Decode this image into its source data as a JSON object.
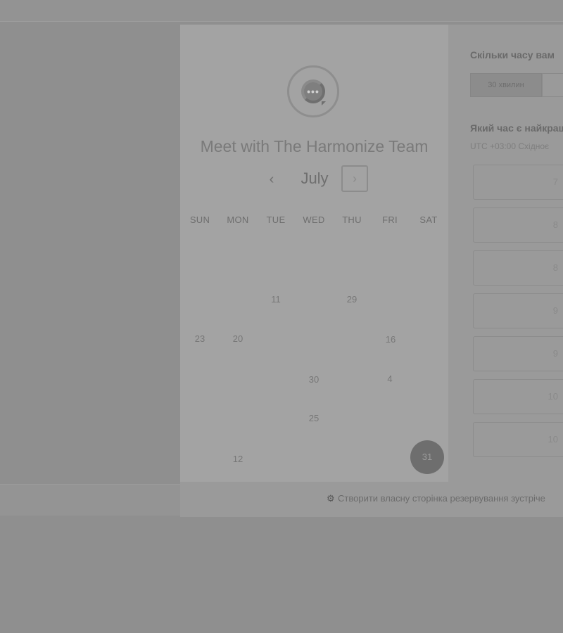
{
  "meeting": {
    "title": "Meet with The Harmonize Team",
    "avatar_icon": "chat-bubble-icon"
  },
  "calendar": {
    "month": "July",
    "prev_symbol": "‹",
    "next_symbol": "›",
    "weekdays": [
      "SUN",
      "MON",
      "TUE",
      "WED",
      "THU",
      "FRI",
      "SAT"
    ],
    "days": [
      "11",
      "29",
      "23",
      "20",
      "16",
      "30",
      "4",
      "25",
      "12",
      "31"
    ],
    "selected_day": "31"
  },
  "right_panel": {
    "duration_heading": "Скільки часу вам",
    "duration_tab": "30 хвилин",
    "time_heading": "Який час є найкращ",
    "timezone": "UTC +03:00 Східноє",
    "slots": [
      "7",
      "8",
      "8",
      "9",
      "9",
      "10",
      "10"
    ]
  },
  "footer": {
    "icon": "hubspot-sprocket-icon",
    "text": "Створити власну сторінка резервування зустріче"
  }
}
